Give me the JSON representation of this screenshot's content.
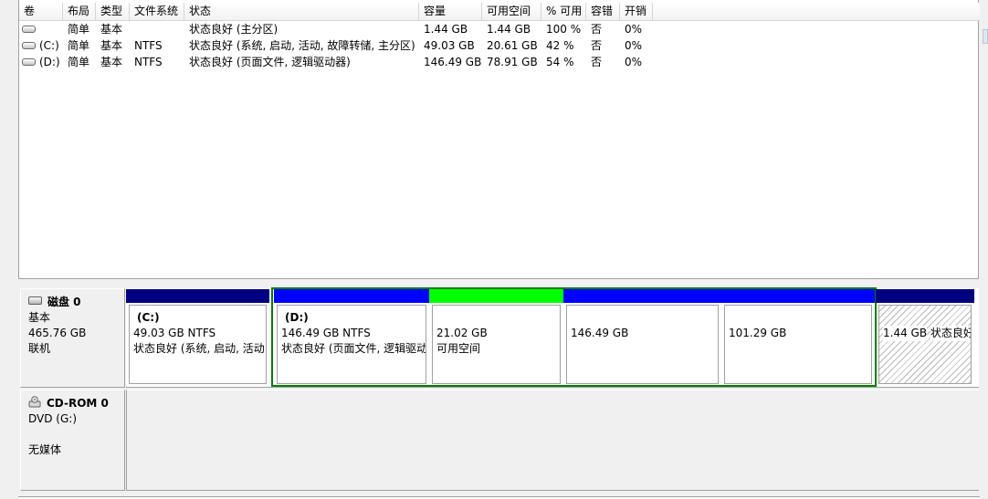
{
  "columns": [
    {
      "key": "volume",
      "label": "卷"
    },
    {
      "key": "layout",
      "label": "布局"
    },
    {
      "key": "type",
      "label": "类型"
    },
    {
      "key": "fs",
      "label": "文件系统"
    },
    {
      "key": "status",
      "label": "状态"
    },
    {
      "key": "capacity",
      "label": "容量"
    },
    {
      "key": "free",
      "label": "可用空间"
    },
    {
      "key": "pct_free",
      "label": "% 可用"
    },
    {
      "key": "fault",
      "label": "容错"
    },
    {
      "key": "overhead",
      "label": "开销"
    }
  ],
  "volumes": [
    {
      "volume": "",
      "layout": "简单",
      "type": "基本",
      "fs": "",
      "status": "状态良好 (主分区)",
      "capacity": "1.44 GB",
      "free": "1.44 GB",
      "pct_free": "100 %",
      "fault": "否",
      "overhead": "0%",
      "icon": "volume-icon"
    },
    {
      "volume": "(C:)",
      "layout": "简单",
      "type": "基本",
      "fs": "NTFS",
      "status": "状态良好 (系统, 启动, 活动, 故障转储, 主分区)",
      "capacity": "49.03 GB",
      "free": "20.61 GB",
      "pct_free": "42 %",
      "fault": "否",
      "overhead": "0%",
      "icon": "volume-icon"
    },
    {
      "volume": "(D:)",
      "layout": "简单",
      "type": "基本",
      "fs": "NTFS",
      "status": "状态良好 (页面文件, 逻辑驱动器)",
      "capacity": "146.49 GB",
      "free": "78.91 GB",
      "pct_free": "54 %",
      "fault": "否",
      "overhead": "0%",
      "icon": "volume-icon"
    }
  ],
  "disk0": {
    "title": "磁盘 0",
    "kind": "基本",
    "size": "465.76 GB",
    "state": "联机",
    "icon": "hard-disk-icon",
    "partitions": [
      {
        "name": "(C:)",
        "line1": "49.03 GB NTFS",
        "line2": "状态良好 (系统, 启动, 活动",
        "bar_color": "#000080"
      },
      {
        "name": "(D:)",
        "line1": "146.49 GB NTFS",
        "line2": "状态良好 (页面文件, 逻辑驱动器)",
        "bar_color": "#0000ff"
      },
      {
        "name": "",
        "line1": "21.02 GB",
        "line2": "可用空间",
        "bar_color": "#00ff00"
      },
      {
        "name": "",
        "line1": "146.49 GB",
        "line2": "",
        "bar_color": "#0000ff"
      },
      {
        "name": "",
        "line1": "101.29 GB",
        "line2": "",
        "bar_color": "#0000ff"
      },
      {
        "name": "",
        "line1": "1.44 GB",
        "line2": "状态良好 (主分区)",
        "bar_color": "#000080"
      }
    ]
  },
  "cdrom0": {
    "title": "CD-ROM 0",
    "drive": "DVD (G:)",
    "media": "无媒体",
    "icon": "cd-drive-icon"
  },
  "colors": {
    "primary_partition": "#000080",
    "logical_drive": "#0000ff",
    "free_space": "#00ff00",
    "extended_partition": "#008000"
  }
}
